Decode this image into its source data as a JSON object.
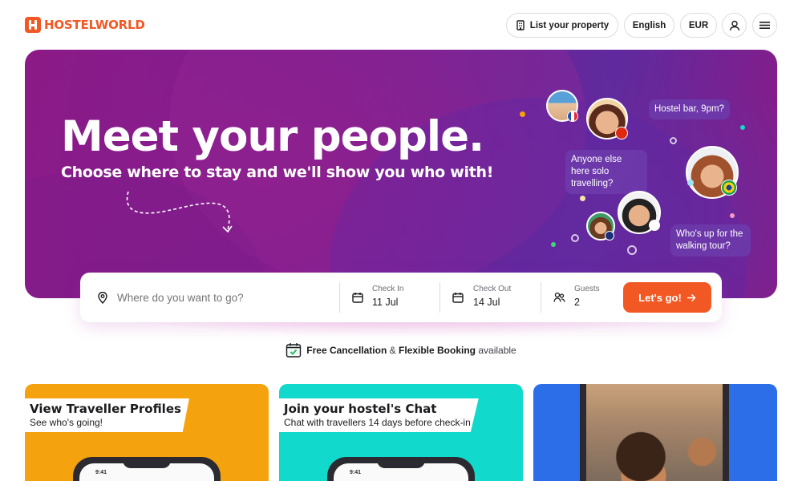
{
  "header": {
    "brand": "HOSTELWORLD",
    "list_property": "List your property",
    "language": "English",
    "currency": "EUR"
  },
  "hero": {
    "title": "Meet your people.",
    "subtitle": "Choose where to stay and we'll show you who with!",
    "bubbles": [
      "Hostel bar, 9pm?",
      "Anyone else here solo travelling?",
      "Who's up for the walking tour?"
    ]
  },
  "search": {
    "destination_placeholder": "Where do you want to go?",
    "checkin_label": "Check In",
    "checkin_value": "11 Jul",
    "checkout_label": "Check Out",
    "checkout_value": "14 Jul",
    "guests_label": "Guests",
    "guests_value": "2",
    "submit_label": "Let's go!"
  },
  "notice": {
    "free_cancellation": "Free Cancellation",
    "and": "&",
    "flexible_booking": "Flexible Booking",
    "available": "available"
  },
  "cards": [
    {
      "title": "View Traveller Profiles",
      "subtitle": "See who's going!",
      "color": "#f5a20f",
      "phone_time": "9:41"
    },
    {
      "title": "Join your hostel's Chat",
      "subtitle": "Chat with travellers 14 days before check-in",
      "color": "#11d9cc",
      "phone_time": "9:41"
    },
    {
      "title": "",
      "subtitle": "",
      "color": "#2b6ee8"
    }
  ],
  "colors": {
    "brand_orange": "#f25824",
    "hero_purple": "#7a1f91"
  },
  "icons": [
    "hostelworld-logo-icon",
    "building-icon",
    "user-icon",
    "menu-icon",
    "location-pin-icon",
    "calendar-icon",
    "guests-icon",
    "arrow-right-icon",
    "calendar-check-icon"
  ]
}
